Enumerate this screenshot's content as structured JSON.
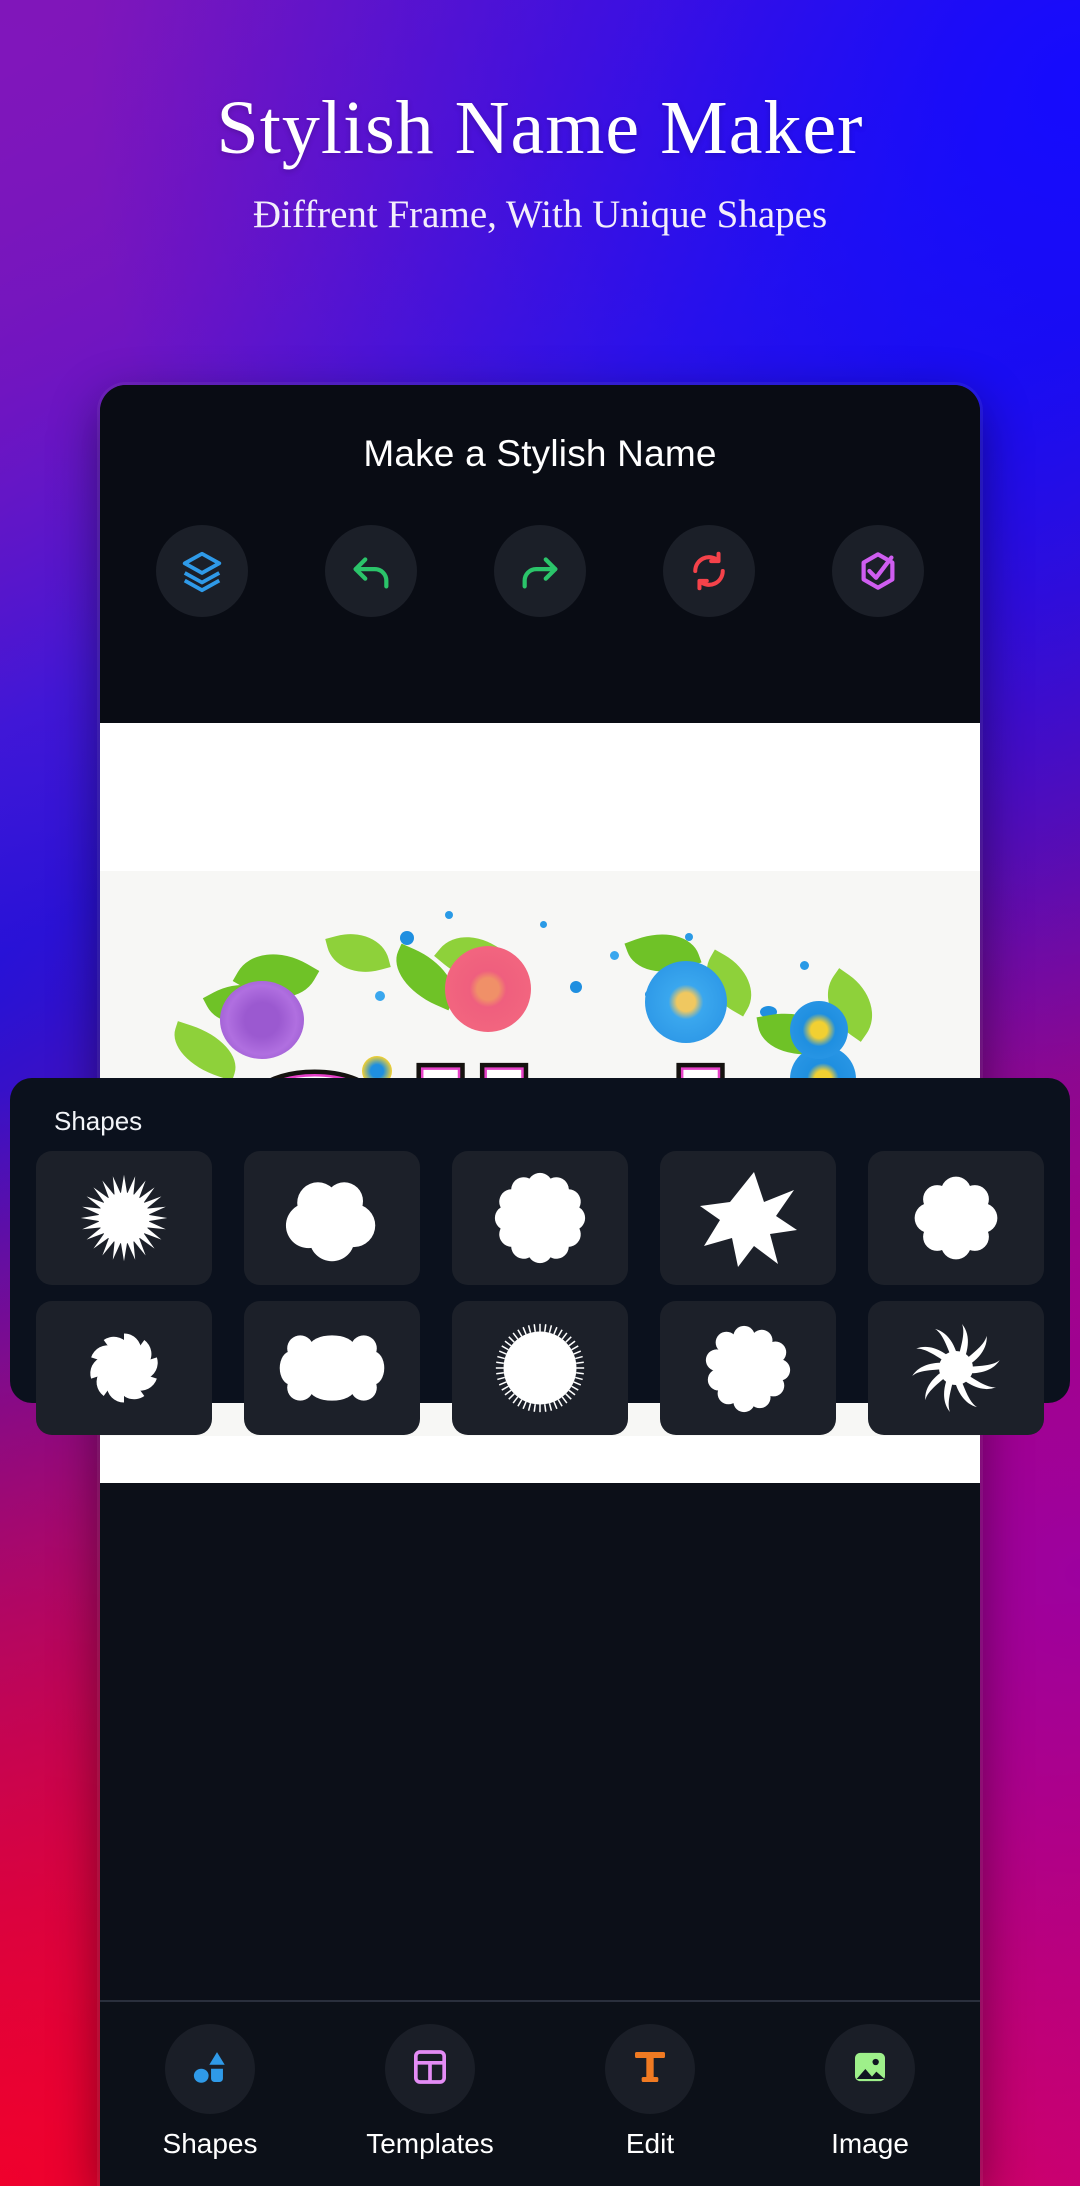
{
  "hero": {
    "title": "Stylish Name Maker",
    "subtitle": "Điffrent Frame, With Unique Shapes"
  },
  "app": {
    "title": "Make a Stylish Name",
    "toolbar": [
      {
        "name": "layers",
        "label": "Layers",
        "color": "#2f9ae8"
      },
      {
        "name": "undo",
        "label": "Undo",
        "color": "#2bc46a"
      },
      {
        "name": "redo",
        "label": "Redo",
        "color": "#2bc46a"
      },
      {
        "name": "reset",
        "label": "Reset",
        "color": "#f5424a"
      },
      {
        "name": "done",
        "label": "Done",
        "color": "#cf5df0"
      }
    ]
  },
  "canvas": {
    "name_text": "Olivia",
    "background": "#f7f7f5",
    "outline_color": "#15120f",
    "inner_outline_color": "#e640c8"
  },
  "shapes_panel": {
    "title": "Shapes",
    "rows": [
      [
        {
          "name": "spiky-starburst",
          "label": "Spiky Starburst"
        },
        {
          "name": "cloud-blob",
          "label": "Cloud"
        },
        {
          "name": "flower-12-petal",
          "label": "Flower"
        },
        {
          "name": "seven-point-star",
          "label": "Star Burst"
        },
        {
          "name": "scalloped-octagon",
          "label": "Scalloped Octagon"
        }
      ],
      [
        {
          "name": "pinwheel-petals",
          "label": "Pinwheel"
        },
        {
          "name": "rounded-banner",
          "label": "Banner"
        },
        {
          "name": "fine-serrated-circle",
          "label": "Serrated Circle"
        },
        {
          "name": "wavy-blob",
          "label": "Wavy Blob"
        },
        {
          "name": "swirl-sun",
          "label": "Swirl Sun"
        }
      ]
    ]
  },
  "bottom_nav": {
    "items": [
      {
        "name": "shapes",
        "label": "Shapes",
        "icon": "shapes-icon",
        "color": "#2f9ae8"
      },
      {
        "name": "templates",
        "label": "Templates",
        "icon": "templates-icon",
        "color": "#e48cf5"
      },
      {
        "name": "edit",
        "label": "Edit",
        "icon": "text-icon",
        "color": "#f07a22"
      },
      {
        "name": "image",
        "label": "Image",
        "icon": "image-icon",
        "color": "#9ef08a"
      }
    ],
    "active": "shapes"
  },
  "colors": {
    "background_start": "#7a1fa8",
    "background_blue": "#2a18df",
    "background_red": "#f00030",
    "panel": "#0b111d",
    "tile": "#1c2029"
  }
}
